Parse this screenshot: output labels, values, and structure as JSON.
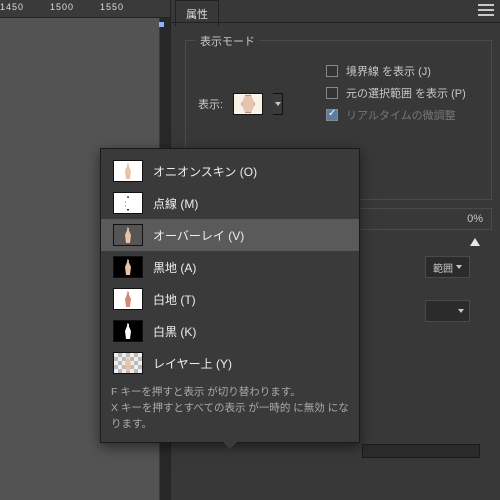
{
  "ruler": {
    "marks": [
      "1450",
      "1500",
      "1550"
    ]
  },
  "panel": {
    "tab": "属性",
    "group_title": "表示モード",
    "display_label": "表示:",
    "checkboxes": [
      {
        "label": "境界線 を表示 (J)",
        "checked": false,
        "enabled": true
      },
      {
        "label": "元の選択範囲 を表示 (P)",
        "checked": false,
        "enabled": true
      },
      {
        "label": "リアルタイムの微調整",
        "checked": true,
        "enabled": false
      }
    ],
    "behind_percent": "0%",
    "behind_select": "範囲"
  },
  "popup": {
    "items": [
      {
        "label": "オニオンスキン (O)",
        "thumb": "white"
      },
      {
        "label": "点線 (M)",
        "thumb": "outline"
      },
      {
        "label": "オーバーレイ (V)",
        "thumb": "gray",
        "selected": true
      },
      {
        "label": "黒地 (A)",
        "thumb": "black"
      },
      {
        "label": "白地 (T)",
        "thumb": "white"
      },
      {
        "label": "白黒 (K)",
        "thumb": "bw"
      },
      {
        "label": "レイヤー上 (Y)",
        "thumb": "checker"
      }
    ],
    "footer1": "F キーを押すと表示 が切り替わります。",
    "footer2": "X キーを押すとすべての表示 が一時的 に無効 になります。"
  }
}
